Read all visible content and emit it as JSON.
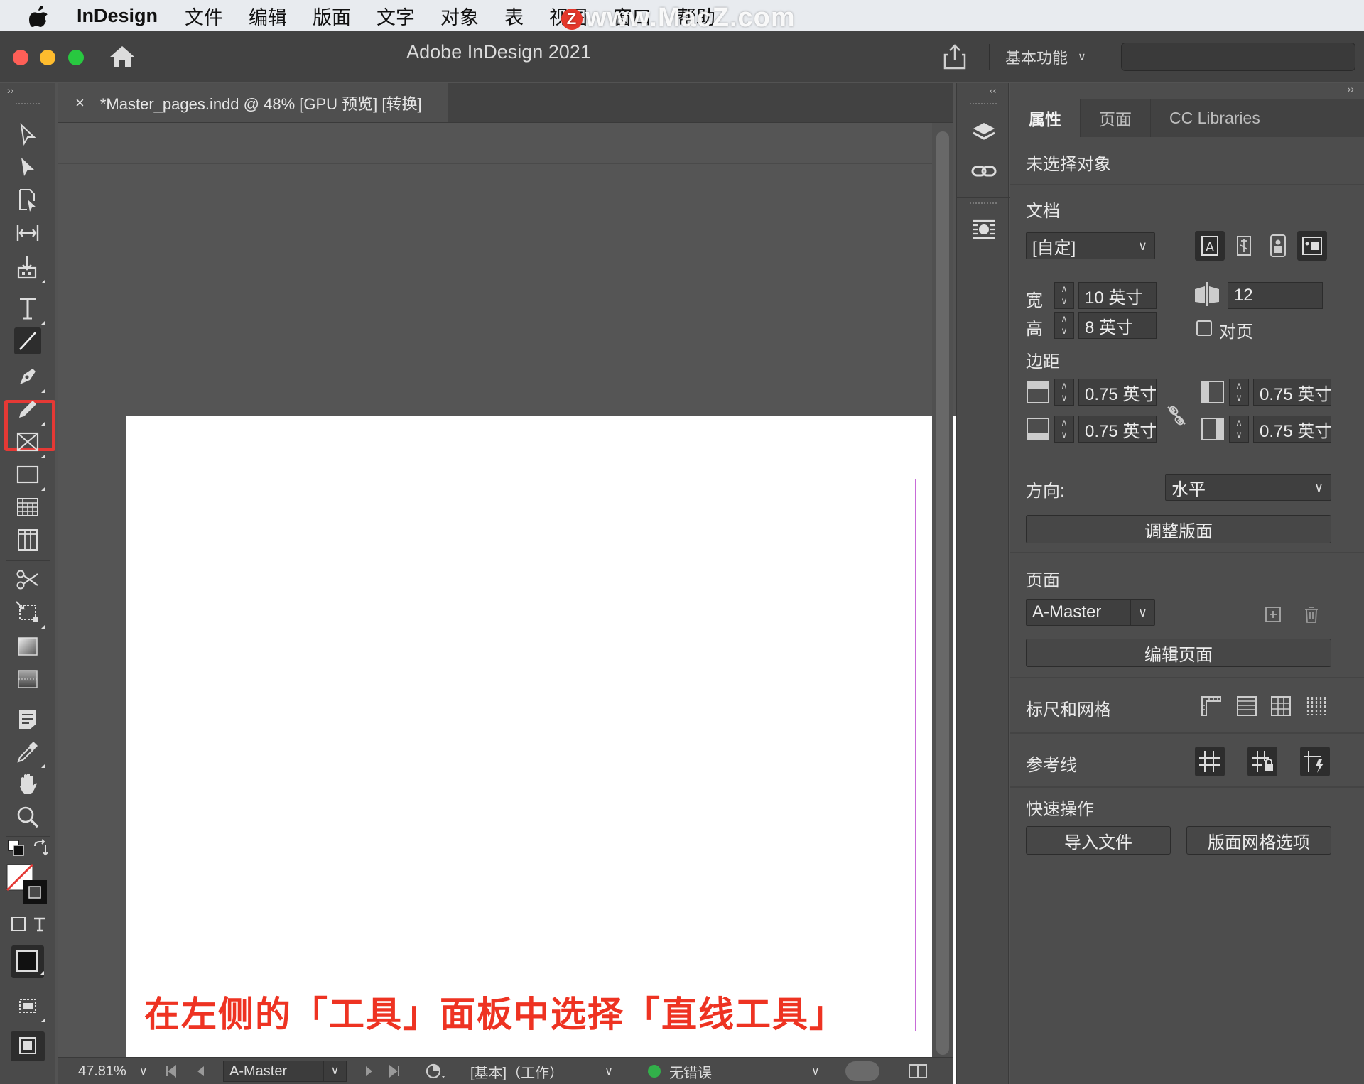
{
  "menubar": {
    "app_name": "InDesign",
    "items": [
      "文件",
      "编辑",
      "版面",
      "文字",
      "对象",
      "表",
      "视图",
      "窗口",
      "帮助"
    ],
    "watermark": "www.MacZ.com",
    "watermark_logo": "Z"
  },
  "titlebar": {
    "title": "Adobe InDesign 2021",
    "workspace": "基本功能"
  },
  "document": {
    "tab_title": "*Master_pages.indd @ 48% [GPU 预览] [转换]",
    "close_glyph": "×",
    "caption": "在左侧的「工具」面板中选择「直线工具」"
  },
  "statusbar": {
    "zoom": "47.81%",
    "page": "A-Master",
    "profile": "[基本]（工作）",
    "preflight": "无错误"
  },
  "panel": {
    "tabs": [
      "属性",
      "页面",
      "CC Libraries"
    ],
    "no_selection": "未选择对象",
    "document": {
      "title": "文档",
      "preset": "[自定]",
      "width_label": "宽",
      "width": "10 英寸",
      "height_label": "高",
      "height": "8 英寸",
      "pages_count": "12",
      "facing_pages": "对页"
    },
    "margins": {
      "title": "边距",
      "top": "0.75 英寸",
      "bottom": "0.75 英寸",
      "left": "0.75 英寸",
      "right": "0.75 英寸"
    },
    "orientation": {
      "label": "方向:",
      "value": "水平"
    },
    "adjust_layout": "调整版面",
    "pages": {
      "title": "页面",
      "value": "A-Master",
      "edit_page": "编辑页面"
    },
    "rulers_grids": "标尺和网格",
    "guides": "参考线",
    "quick_actions": {
      "title": "快速操作",
      "import_file": "导入文件",
      "layout_grid": "版面网格选项"
    }
  },
  "colors": {
    "highlight": "#e53935",
    "margin_guide": "#c86bd8",
    "caption": "#ee3322",
    "preflight_ok": "#32b04a"
  }
}
